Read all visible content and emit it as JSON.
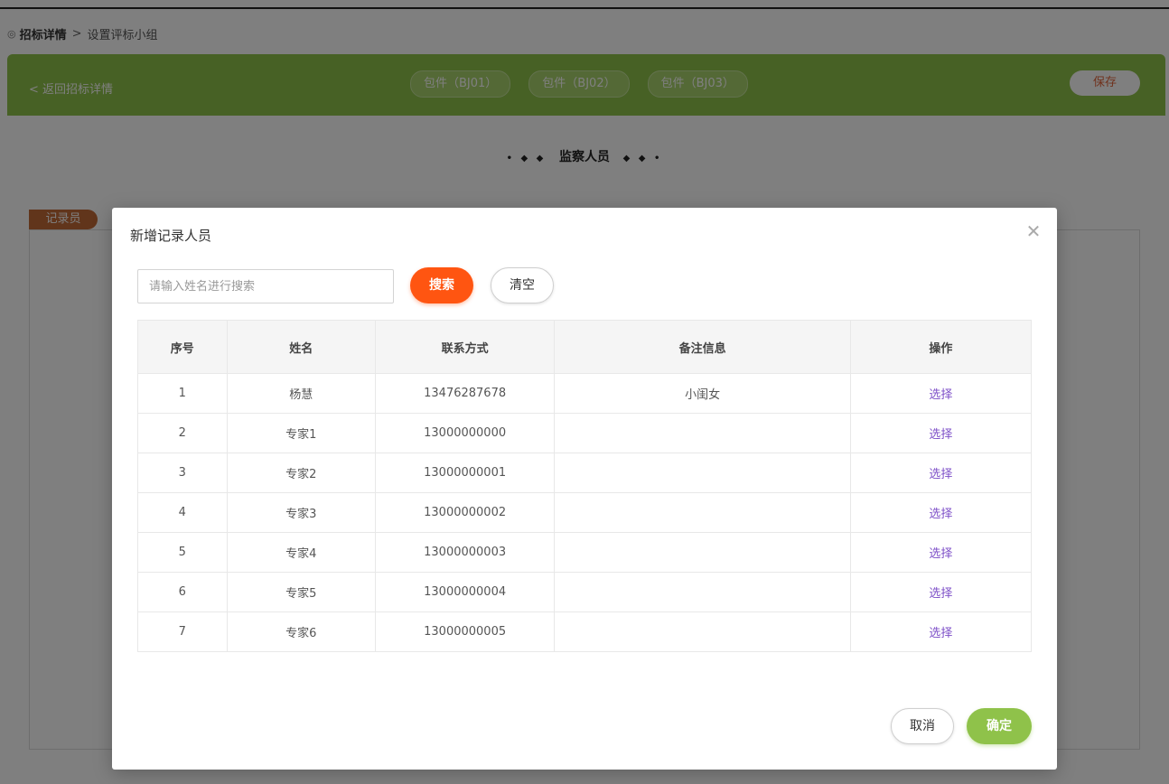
{
  "breadcrumb": {
    "icon": "circle-arrow-icon",
    "main": "招标详情",
    "separator": ">",
    "sub": "设置评标小组"
  },
  "header": {
    "back_label": "< 返回招标详情",
    "package_tabs": [
      "包件（BJ01）",
      "包件（BJ02）",
      "包件（BJ03）"
    ],
    "save_label": "保存"
  },
  "section": {
    "dots_left": "• ◆ ◆",
    "title": "监察人员",
    "dots_right": "◆ ◆ •"
  },
  "recorder_tag": "记录员",
  "dialog": {
    "title": "新增记录人员",
    "close_icon": "close-icon",
    "search_placeholder": "请输入姓名进行搜索",
    "search_label": "搜索",
    "clear_label": "清空",
    "columns": [
      "序号",
      "姓名",
      "联系方式",
      "备注信息",
      "操作"
    ],
    "rows": [
      {
        "idx": "1",
        "name": "杨慧",
        "phone": "13476287678",
        "note": "小闺女",
        "action": "选择"
      },
      {
        "idx": "2",
        "name": "专家1",
        "phone": "13000000000",
        "note": "",
        "action": "选择"
      },
      {
        "idx": "3",
        "name": "专家2",
        "phone": "13000000001",
        "note": "",
        "action": "选择"
      },
      {
        "idx": "4",
        "name": "专家3",
        "phone": "13000000002",
        "note": "",
        "action": "选择"
      },
      {
        "idx": "5",
        "name": "专家4",
        "phone": "13000000003",
        "note": "",
        "action": "选择"
      },
      {
        "idx": "6",
        "name": "专家5",
        "phone": "13000000004",
        "note": "",
        "action": "选择"
      },
      {
        "idx": "7",
        "name": "专家6",
        "phone": "13000000005",
        "note": "",
        "action": "选择"
      }
    ],
    "cancel_label": "取消",
    "confirm_label": "确定"
  },
  "colors": {
    "header_green": "#8fc24a",
    "search_orange": "#ff5511",
    "recorder_tag": "#c26a37",
    "link_purple": "#7d4fc8"
  }
}
